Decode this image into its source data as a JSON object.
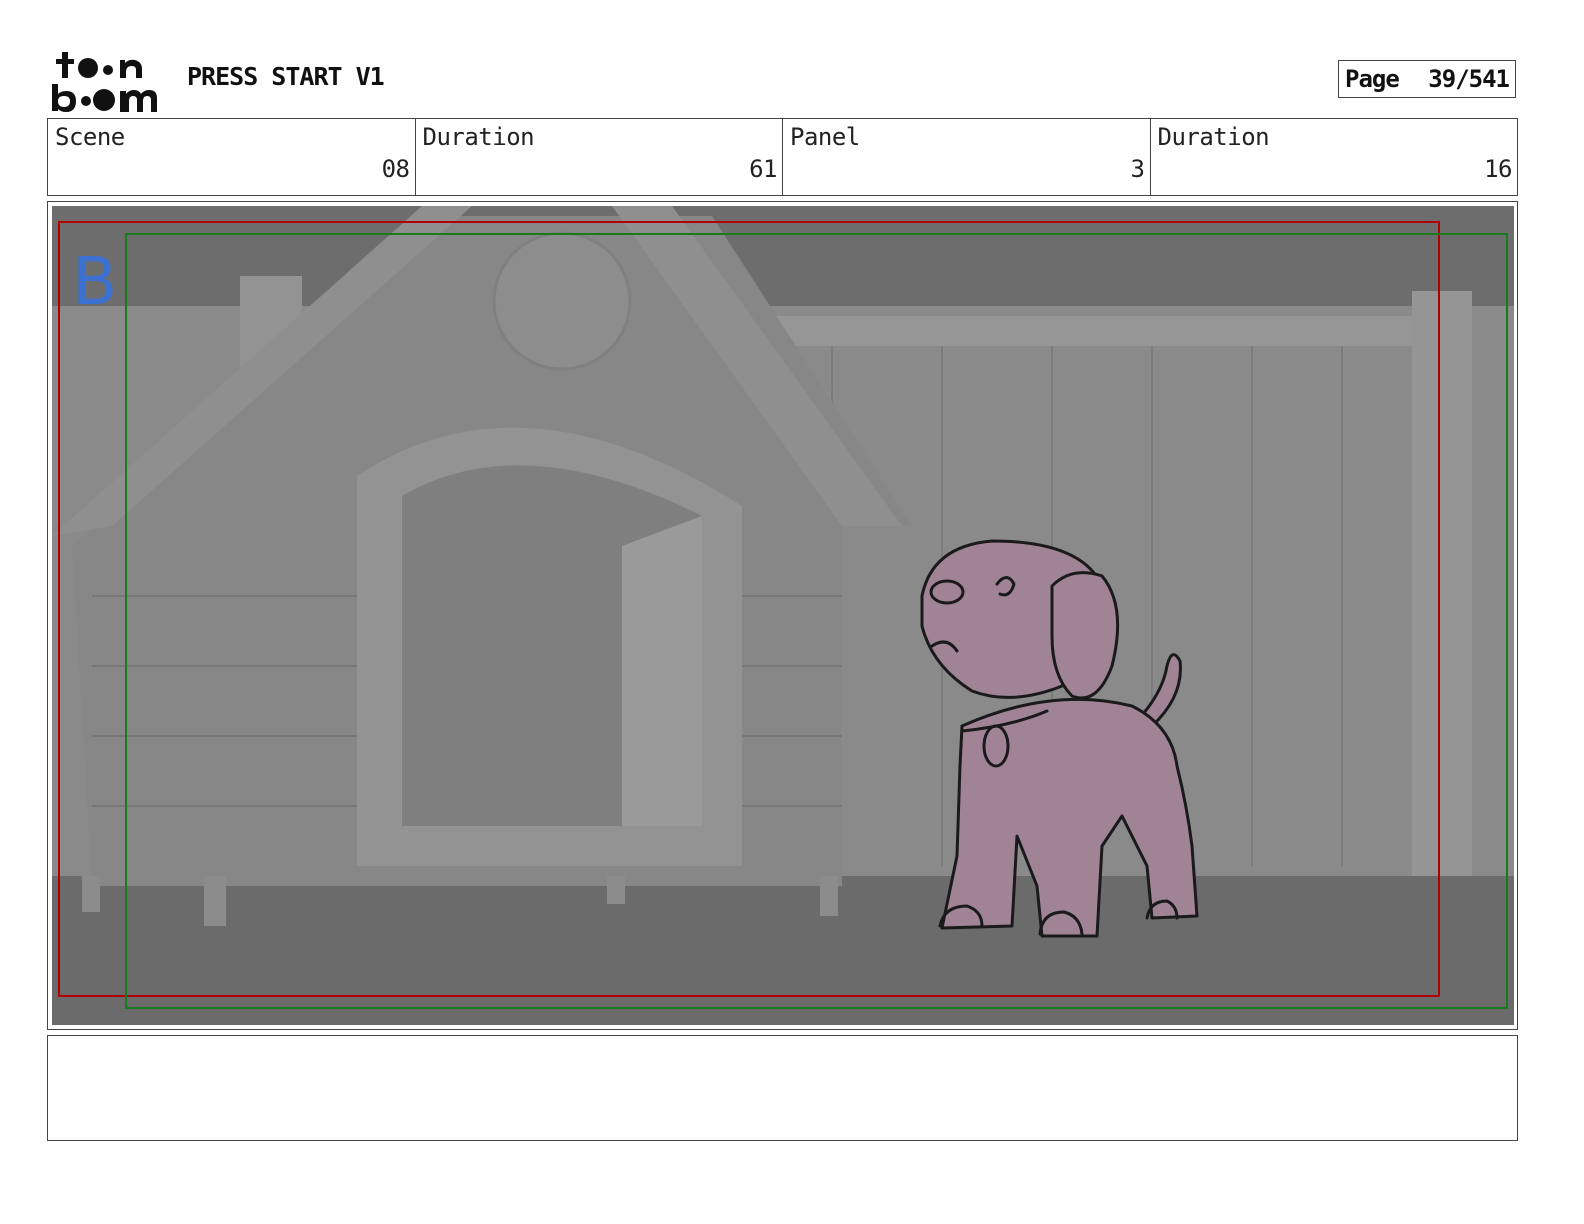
{
  "header": {
    "logo_text": "toon boom",
    "project_title": "PRESS START V1",
    "page_label": "Page",
    "page_number": "39/541"
  },
  "info": [
    {
      "label": "Scene",
      "value": "08"
    },
    {
      "label": "Duration",
      "value": "61"
    },
    {
      "label": "Panel",
      "value": "3"
    },
    {
      "label": "Duration",
      "value": "16"
    }
  ],
  "panel": {
    "layer_letter": "B",
    "safe_frame_colors": {
      "action": "#b00000",
      "title": "#1b7a1b"
    },
    "sketch_fill": "#a08496"
  },
  "notes": {
    "text": ""
  }
}
